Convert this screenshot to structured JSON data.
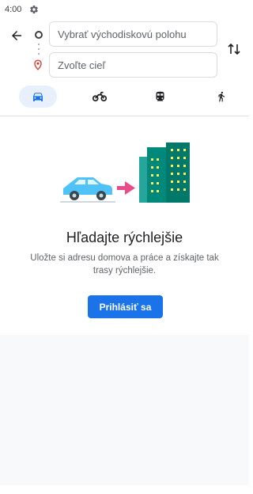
{
  "status_bar": {
    "time": "4:00",
    "settings_icon": "gear-icon"
  },
  "search": {
    "origin_placeholder": "Vybrať východiskovú polohu",
    "destination_placeholder": "Zvoľte cieľ"
  },
  "icons": {
    "back": "arrow-left-icon",
    "swap": "swap-vertical-icon",
    "origin": "circle-outline-icon",
    "destination": "location-pin-icon"
  },
  "modes": [
    {
      "id": "car",
      "icon": "car-icon",
      "active": true
    },
    {
      "id": "motorcycle",
      "icon": "motorcycle-icon",
      "active": false
    },
    {
      "id": "transit",
      "icon": "train-icon",
      "active": false
    },
    {
      "id": "walk",
      "icon": "walk-icon",
      "active": false
    }
  ],
  "promo": {
    "title": "Hľadajte rýchlejšie",
    "description": "Uložte si adresu domova a práce a získajte tak trasy rýchlejšie.",
    "signin_label": "Prihlásiť sa"
  },
  "colors": {
    "accent": "#1a73e8",
    "active_mode_bg": "#e8f0fe",
    "destination_pin": "#d93025",
    "illustration_arrow": "#ea4c89",
    "illustration_car": "#4fc3f7",
    "illustration_building": "#00897b"
  }
}
